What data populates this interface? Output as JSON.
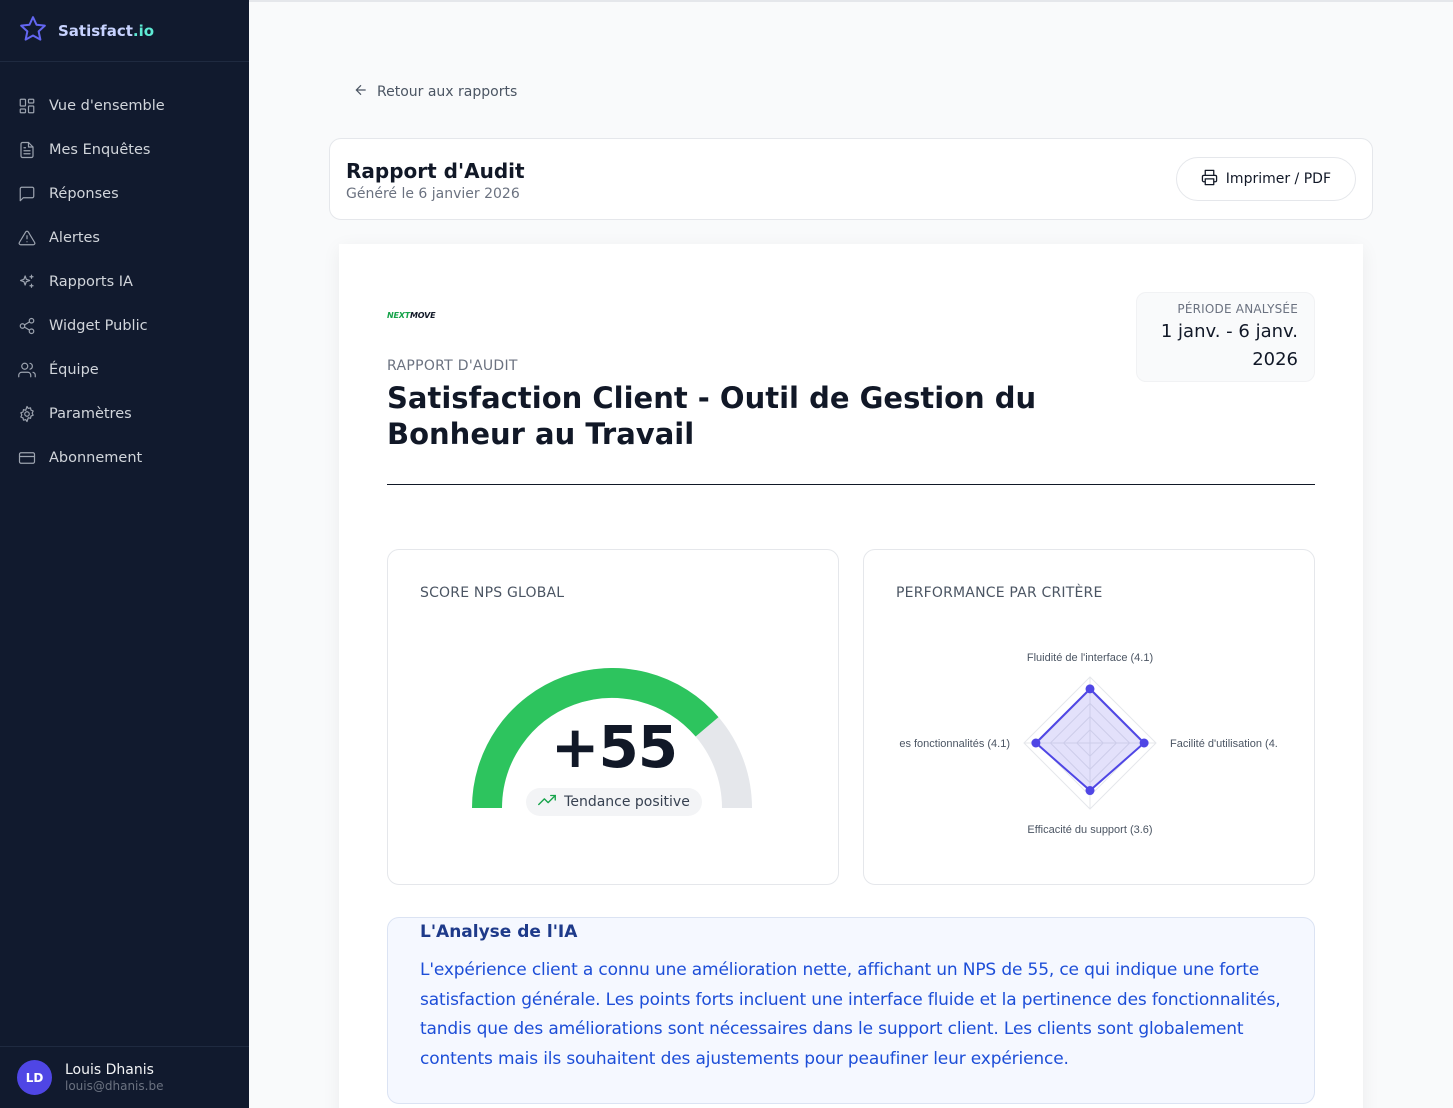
{
  "brand": {
    "name": "Satisfact",
    "tld": ".io"
  },
  "sidebar": {
    "items": [
      {
        "label": "Vue d'ensemble",
        "icon": "grid-icon"
      },
      {
        "label": "Mes Enquêtes",
        "icon": "document-icon"
      },
      {
        "label": "Réponses",
        "icon": "message-icon"
      },
      {
        "label": "Alertes",
        "icon": "alert-triangle-icon"
      },
      {
        "label": "Rapports IA",
        "icon": "sparkles-icon"
      },
      {
        "label": "Widget Public",
        "icon": "share-icon"
      },
      {
        "label": "Équipe",
        "icon": "users-icon"
      },
      {
        "label": "Paramètres",
        "icon": "gear-icon"
      },
      {
        "label": "Abonnement",
        "icon": "credit-card-icon"
      }
    ]
  },
  "user": {
    "initials": "LD",
    "name": "Louis Dhanis",
    "email": "louis@dhanis.be"
  },
  "back_link": "Retour aux rapports",
  "header": {
    "title": "Rapport d'Audit",
    "subtitle": "Généré le 6 janvier 2026",
    "print_label": "Imprimer / PDF"
  },
  "report": {
    "logo_a": "NEXT",
    "logo_b": "MOVE",
    "period_label": "PÉRIODE ANALYSÉE",
    "period_line1": "1 janv. - 6 janv.",
    "period_line2": "2026",
    "kicker": "RAPPORT D'AUDIT",
    "title": "Satisfaction Client - Outil de Gestion du Bonheur au Travail"
  },
  "nps": {
    "label": "SCORE NPS GLOBAL",
    "value": 55,
    "display": "+55",
    "trend": "Tendance positive",
    "scale_min": -100,
    "scale_max": 100,
    "fill_color": "#2dc45e",
    "track_color": "#e5e7eb"
  },
  "radar": {
    "label": "PERFORMANCE PAR CRITÈRE",
    "max": 5,
    "color": "#4f46e5",
    "criteria": [
      {
        "label": "Fluidité de l'interface (4.1)",
        "value": 4.1
      },
      {
        "label": "Facilité d'utilisation (4.",
        "value": 4.1
      },
      {
        "label": "Efficacité du support (3.6)",
        "value": 3.6
      },
      {
        "label": "es fonctionnalités (4.1)",
        "value": 4.1
      }
    ]
  },
  "ai": {
    "title": "L'Analyse de l'IA",
    "text": "L'expérience client a connu une amélioration nette, affichant un NPS de 55, ce qui indique une forte satisfaction générale. Les points forts incluent une interface fluide et la pertinence des fonctionnalités, tandis que des améliorations sont nécessaires dans le support client. Les clients sont globalement contents mais ils souhaitent des ajustements pour peaufiner leur expérience."
  }
}
